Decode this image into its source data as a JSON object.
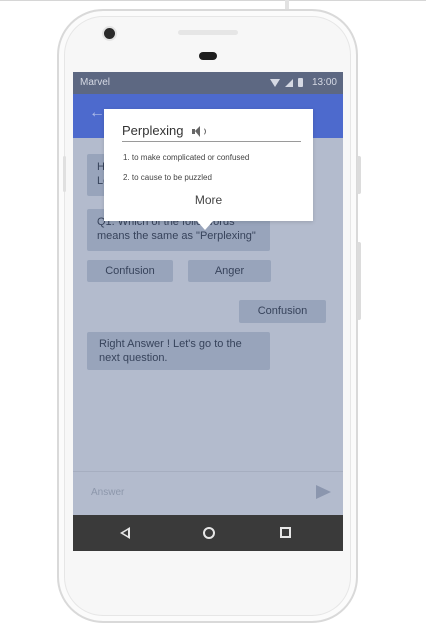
{
  "statusbar": {
    "carrier": "Marvel",
    "time": "13:00"
  },
  "chat": {
    "bubble_1": [
      "He",
      "Le"
    ],
    "question": [
      "Q1. Which of the follo",
      "words",
      "means the same as  \"Perplexing\""
    ],
    "options": [
      "Confusion",
      "Anger"
    ],
    "user_answer": "Confusion",
    "feedback": [
      "Right Answer ! Let's go to the",
      "next question."
    ]
  },
  "composer": {
    "placeholder": "Answer"
  },
  "popup": {
    "word": "Perplexing",
    "definitions": [
      "1.  to make complicated or confused",
      "2.  to cause to be puzzled"
    ],
    "more_label": "More"
  },
  "colors": {
    "app_bar": "#4d6acd",
    "overlay": "#b3bbcd",
    "bubble": "#98a4bb",
    "nav_bar": "#3a3a3a"
  }
}
